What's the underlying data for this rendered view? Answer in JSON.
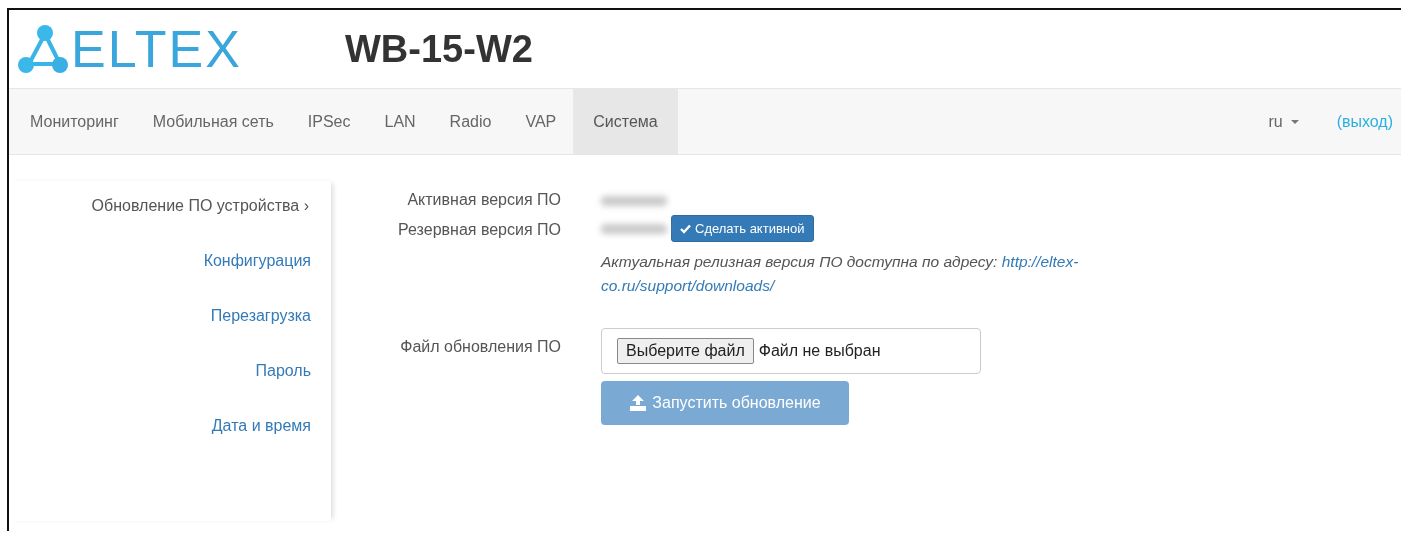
{
  "header": {
    "logo": "ELTEX",
    "model": "WB-15-W2"
  },
  "nav": {
    "tabs": [
      {
        "label": "Мониторинг",
        "selected": false
      },
      {
        "label": "Мобильная сеть",
        "selected": false
      },
      {
        "label": "IPSec",
        "selected": false
      },
      {
        "label": "LAN",
        "selected": false
      },
      {
        "label": "Radio",
        "selected": false
      },
      {
        "label": "VAP",
        "selected": false
      },
      {
        "label": "Система",
        "selected": true
      }
    ],
    "language": "ru",
    "logout": "(выход)"
  },
  "sidebar": {
    "items": [
      {
        "label": "Обновление ПО устройства ›",
        "selected": true
      },
      {
        "label": "Конфигурация",
        "selected": false
      },
      {
        "label": "Перезагрузка",
        "selected": false
      },
      {
        "label": "Пароль",
        "selected": false
      },
      {
        "label": "Дата и время",
        "selected": false
      }
    ]
  },
  "form": {
    "active_label": "Активная версия ПО",
    "backup_label": "Резервная версия ПО",
    "make_active_button": "Сделать активной",
    "note": "Актуальная релизная версия ПО доступна по адресу: ",
    "note_link": [
      "http://eltex-",
      "co.ru/support/downloads/"
    ],
    "file_label": "Файл обновления ПО",
    "choose_button": "Выберите файл",
    "file_status": "Файл не выбран",
    "start_button": {
      "label": "Запустить обновление",
      "disabled": true
    }
  }
}
